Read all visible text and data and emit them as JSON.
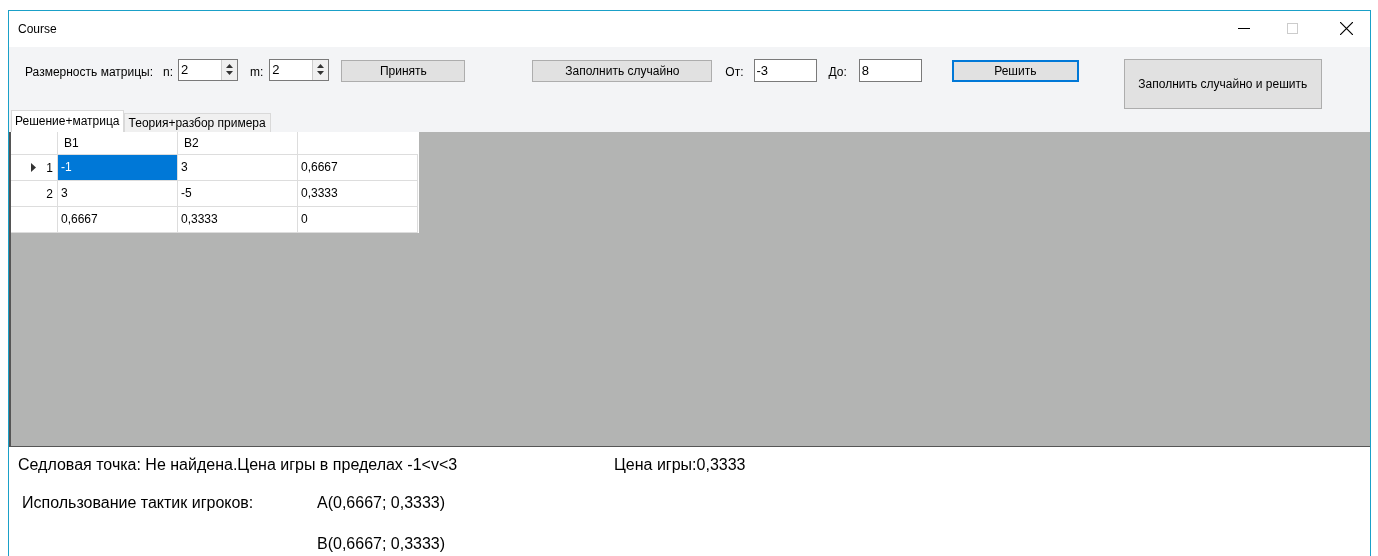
{
  "window": {
    "title": "Course"
  },
  "toolbar": {
    "dimension_label": "Размерность матрицы:",
    "n": {
      "label": "n:",
      "value": "2"
    },
    "m": {
      "label": "m:",
      "value": "2"
    },
    "accept_button": "Принять",
    "fill_random_button": "Заполнить случайно",
    "from": {
      "label": "От:",
      "value": "-3"
    },
    "to": {
      "label": "До:",
      "value": "8"
    },
    "solve_button": {
      "label": "Решить",
      "focused": true
    },
    "fill_and_solve_button": "Заполнить случайно и решить"
  },
  "tabs": [
    {
      "label": "Решение+матрица",
      "selected": true
    },
    {
      "label": "Теория+разбор примера",
      "selected": false
    }
  ],
  "grid": {
    "columns": [
      "B1",
      "B2"
    ],
    "rows": [
      {
        "header": "1",
        "current": true,
        "cells": [
          {
            "text": "-1",
            "selected": true
          },
          {
            "text": "3",
            "selected": false
          },
          {
            "text": "0,6667",
            "selected": false
          }
        ]
      },
      {
        "header": "2",
        "current": false,
        "cells": [
          {
            "text": "3",
            "selected": false
          },
          {
            "text": "-5",
            "selected": false
          },
          {
            "text": "0,3333",
            "selected": false
          }
        ]
      },
      {
        "current": false,
        "cells": [
          {
            "text": "0,6667",
            "selected": false
          },
          {
            "text": "0,3333",
            "selected": false
          },
          {
            "text": "0",
            "selected": false
          }
        ]
      }
    ]
  },
  "results": {
    "saddle_point": "Седловая точка: Не найдена.Цена игры в пределах -1<v<3",
    "game_value": "Цена игры:0,3333",
    "strategies_label": "Использование тактик игроков:",
    "strategy_a": "A(0,6667; 0,3333)",
    "strategy_b": "B(0,6667; 0,3333)"
  }
}
